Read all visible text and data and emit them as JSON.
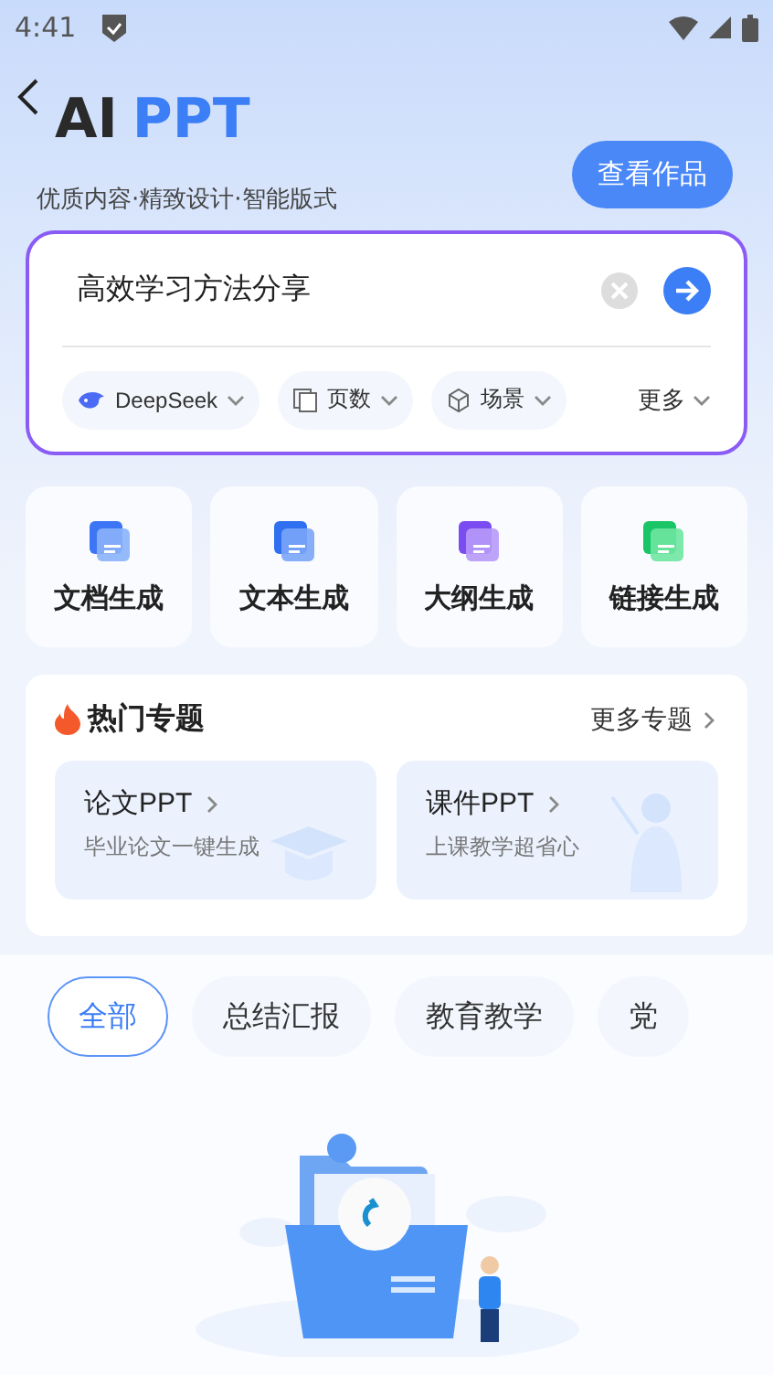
{
  "status_bar": {
    "time": "4:41"
  },
  "header": {
    "title_dark": "AI",
    "title_accent": "PPT",
    "subtitle": "优质内容·精致设计·智能版式",
    "works_button": "查看作品"
  },
  "prompt": {
    "value": "高效学习方法分享",
    "options": [
      {
        "kind": "model",
        "label": "DeepSeek"
      },
      {
        "kind": "pages",
        "label": "页数"
      },
      {
        "kind": "scene",
        "label": "场景"
      }
    ],
    "more": "更多"
  },
  "tools": [
    {
      "kind": "doc",
      "label": "文档生成"
    },
    {
      "kind": "text",
      "label": "文本生成"
    },
    {
      "kind": "outline",
      "label": "大纲生成"
    },
    {
      "kind": "link",
      "label": "链接生成"
    }
  ],
  "hot_topics": {
    "title": "热门专题",
    "more": "更多专题",
    "cards": [
      {
        "kind": "thesis",
        "title": "论文PPT",
        "subtitle": "毕业论文一键生成"
      },
      {
        "kind": "courseware",
        "title": "课件PPT",
        "subtitle": "上课教学超省心"
      }
    ]
  },
  "categories": [
    {
      "label": "全部",
      "selected": true
    },
    {
      "label": "总结汇报",
      "selected": false
    },
    {
      "label": "教育教学",
      "selected": false
    },
    {
      "label": "党",
      "selected": false
    }
  ]
}
